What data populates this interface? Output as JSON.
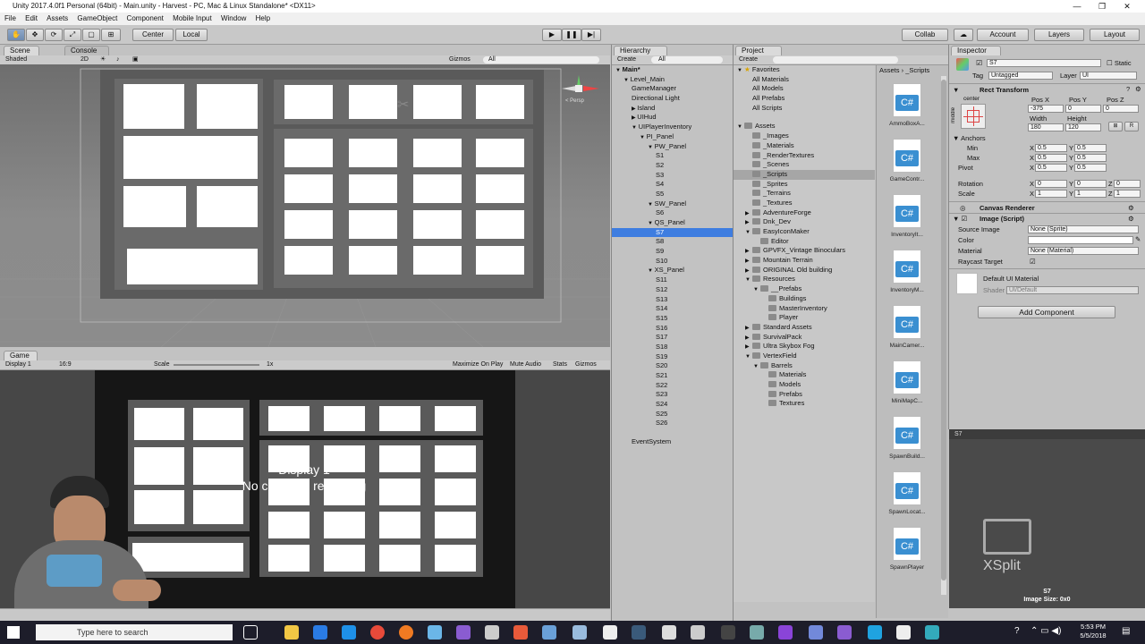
{
  "window_title": "Unity 2017.4.0f1 Personal (64bit) - Main.unity - Harvest - PC, Mac & Linux Standalone* <DX11>",
  "menu": [
    "File",
    "Edit",
    "Assets",
    "GameObject",
    "Component",
    "Mobile Input",
    "Window",
    "Help"
  ],
  "toolbar": {
    "pivot": "Center",
    "space": "Local",
    "collab": "Collab",
    "account": "Account",
    "layers": "Layers",
    "layout": "Layout"
  },
  "scene": {
    "tab": "Scene",
    "console_tab": "Console",
    "shading": "Shaded",
    "mode2d": "2D",
    "gizmos": "Gizmos",
    "search": "All",
    "persp": "< Persp"
  },
  "game": {
    "tab": "Game",
    "display": "Display 1",
    "aspect": "16:9",
    "scale_label": "Scale",
    "scale_value": "1x",
    "max": "Maximize On Play",
    "mute": "Mute Audio",
    "stats": "Stats",
    "gizmos": "Gizmos",
    "overlay1": "Display 1",
    "overlay2": "No cameras rendering"
  },
  "hierarchy": {
    "tab": "Hierarchy",
    "create": "Create",
    "search": "All",
    "items": [
      "Main*",
      "Level_Main",
      "GameManager",
      "Directional Light",
      "Island",
      "UIHud",
      "UIPlayerInventory",
      "PI_Panel",
      "PW_Panel",
      "S1",
      "S2",
      "S3",
      "S4",
      "S5",
      "SW_Panel",
      "S6",
      "QS_Panel",
      "S7",
      "S8",
      "S9",
      "S10",
      "XS_Panel",
      "S11",
      "S12",
      "S13",
      "S14",
      "S15",
      "S16",
      "S17",
      "S18",
      "S19",
      "S20",
      "S21",
      "S22",
      "S23",
      "S24",
      "S25",
      "S26",
      "EventSystem"
    ],
    "selected": "S7"
  },
  "project": {
    "tab": "Project",
    "create": "Create",
    "breadcrumb_root": "Assets",
    "breadcrumb_leaf": "_Scripts",
    "favorites_label": "Favorites",
    "favorites": [
      "All Materials",
      "All Models",
      "All Prefabs",
      "All Scripts"
    ],
    "assets_label": "Assets",
    "folders": [
      "_Images",
      "_Materials",
      "_RenderTextures",
      "_Scenes",
      "_Scripts",
      "_Sprites",
      "_Terrains",
      "_Textures",
      "AdventureForge",
      "Dnk_Dev",
      "EasyIconMaker",
      "Editor",
      "GPVFX_Vintage Binoculars",
      "Mountain Terrain",
      "ORIGINAL Old building",
      "Resources",
      "__Prefabs",
      "Buildings",
      "MasterInventory",
      "Player",
      "Standard Assets",
      "SurvivalPack",
      "Ultra Skybox Fog",
      "VertexField",
      "Barrels",
      "Materials",
      "Models",
      "Prefabs",
      "Textures"
    ],
    "scripts": [
      "AmmoBoxA...",
      "GameContr...",
      "InventoryIt...",
      "InventoryM...",
      "MainCamer...",
      "MiniMapC...",
      "SpawnBuild...",
      "SpawnLocat...",
      "SpawnPlayer"
    ]
  },
  "inspector": {
    "tab": "Inspector",
    "name": "S7",
    "static": "Static",
    "tag_label": "Tag",
    "tag": "Untagged",
    "layer_label": "Layer",
    "layer": "UI",
    "rect_transform": "Rect Transform",
    "center": "center",
    "middle": "middle",
    "posx_label": "Pos X",
    "posy_label": "Pos Y",
    "posz_label": "Pos Z",
    "posx": "-375",
    "posy": "0",
    "posz": "0",
    "width_label": "Width",
    "height_label": "Height",
    "width": "180",
    "height": "120",
    "anchors": "Anchors",
    "min": "Min",
    "max": "Max",
    "pivot": "Pivot",
    "rotation": "Rotation",
    "scale": "Scale",
    "min_x": "0.5",
    "min_y": "0.5",
    "max_x": "0.5",
    "max_y": "0.5",
    "pivot_x": "0.5",
    "pivot_y": "0.5",
    "rot_x": "0",
    "rot_y": "0",
    "rot_z": "0",
    "sc_x": "1",
    "sc_y": "1",
    "sc_z": "1",
    "canvas_renderer": "Canvas Renderer",
    "image_script": "Image (Script)",
    "source_image_label": "Source Image",
    "source_image": "None (Sprite)",
    "color_label": "Color",
    "material_label": "Material",
    "material": "None (Material)",
    "raycast_label": "Raycast Target",
    "default_mat": "Default UI Material",
    "shader_label": "Shader",
    "shader": "UI/Default",
    "add_component": "Add Component",
    "preview_title": "S7",
    "preview_name": "S7",
    "preview_size": "Image Size: 0x0",
    "xsplit": "XSplit"
  },
  "taskbar": {
    "search": "Type here to search",
    "time": "5:53 PM",
    "date": "5/5/2018"
  }
}
